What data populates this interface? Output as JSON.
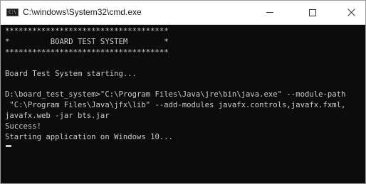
{
  "window": {
    "title": "C:\\windows\\System32\\cmd.exe",
    "app_icon_text": "C:\\",
    "background_color": "#0c0c0c",
    "text_color": "#cccccc"
  },
  "console": {
    "lines": [
      "************************************",
      "*         BOARD TEST SYSTEM        *",
      "************************************",
      "",
      "Board Test System starting...",
      "",
      "D:\\board_test_system>\"C:\\Program Files\\Java\\jre\\bin\\java.exe\" --module-path",
      " \"C:\\Program Files\\Java\\jfx\\lib\" --add-modules javafx.controls,javafx.fxml,",
      "javafx.web -jar bts.jar",
      "Success!",
      "Starting application on Windows 10..."
    ]
  }
}
